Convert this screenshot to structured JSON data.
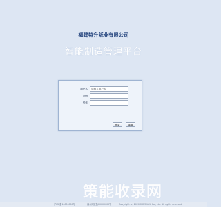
{
  "header": {
    "company_name": "福建特升纸业有限公司",
    "system_title": "智能制造管理平台"
  },
  "login": {
    "account_label": "用户名",
    "account_placeholder": "请输入用户名",
    "password_label": "密码",
    "code_label": "验证",
    "login_button": "登录",
    "reset_button": "重置"
  },
  "footer": {
    "icp": "沪ICP备10000000号",
    "police": "闽公网安备00000000号",
    "copyright": "Copyright (c) 2020-2023 XXX Co., Ltd. All rights reserved."
  },
  "watermark": {
    "text": "策能收录网"
  },
  "colors": {
    "background": "#dde6f3",
    "company_text": "#1c3d78",
    "panel_border": "#9fb4d2"
  }
}
